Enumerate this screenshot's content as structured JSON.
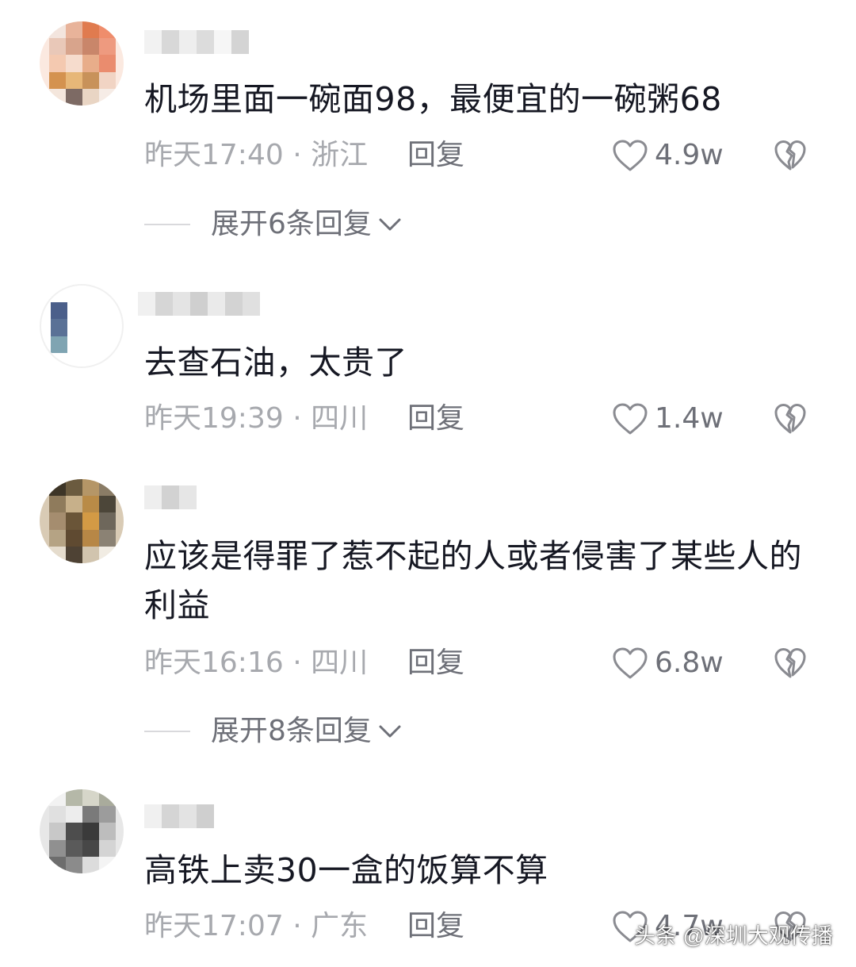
{
  "comments": [
    {
      "text": "机场里面一碗面98，最便宜的一碗粥68",
      "time_location": "昨天17:40 · 浙江",
      "reply_label": "回复",
      "likes": "4.9w",
      "expand_label": "展开6条回复"
    },
    {
      "text": "去查石油，太贵了",
      "time_location": "昨天19:39 · 四川",
      "reply_label": "回复",
      "likes": "1.4w"
    },
    {
      "text": "应该是得罪了惹不起的人或者侵害了某些人的利益",
      "time_location": "昨天16:16 · 四川",
      "reply_label": "回复",
      "likes": "6.8w",
      "expand_label": "展开8条回复"
    },
    {
      "text": "高铁上卖30一盒的饭算不算",
      "time_location": "昨天17:07 · 广东",
      "reply_label": "回复",
      "likes": "4.7w"
    }
  ],
  "watermark": "头条 @深圳大观传播",
  "colors": {
    "text_primary": "#161823",
    "text_secondary": "#6e7078",
    "text_time": "#a7a9ae",
    "icon_stroke": "#8a8b91"
  },
  "icons": {
    "like": "heart-outline-icon",
    "dislike": "broken-heart-icon",
    "expand": "chevron-down-icon"
  }
}
